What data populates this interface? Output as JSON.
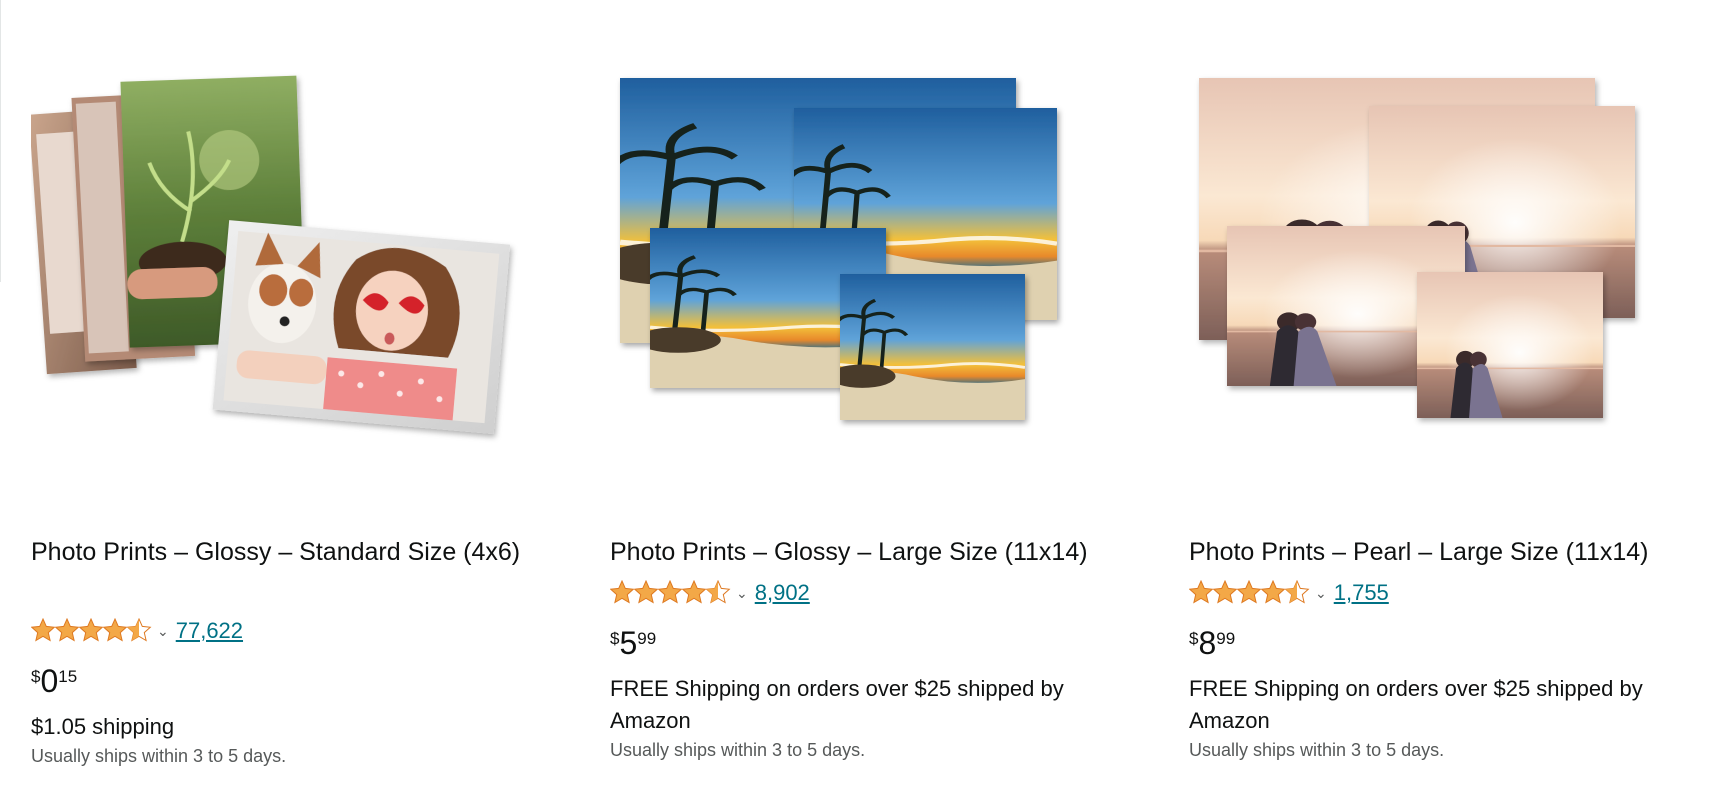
{
  "products": [
    {
      "title": "Photo Prints – Glossy – Standard Size (4x6)",
      "rating": 4.5,
      "rating_label": "4.5 out of 5 stars",
      "review_count": "77,622",
      "price": {
        "symbol": "$",
        "whole": "0",
        "fraction": "15"
      },
      "shipping": "$1.05 shipping",
      "ships_note": "Usually ships within 3 to 5 days."
    },
    {
      "title": "Photo Prints – Glossy – Large Size (11x14)",
      "rating": 4.5,
      "rating_label": "4.5 out of 5 stars",
      "review_count": "8,902",
      "price": {
        "symbol": "$",
        "whole": "5",
        "fraction": "99"
      },
      "shipping": "FREE Shipping on orders over $25 shipped by Amazon",
      "ships_note": "Usually ships within 3 to 5 days."
    },
    {
      "title": "Photo Prints – Pearl – Large Size (11x14)",
      "rating": 4.5,
      "rating_label": "4.5 out of 5 stars",
      "review_count": "1,755",
      "price": {
        "symbol": "$",
        "whole": "8",
        "fraction": "99"
      },
      "shipping": "FREE Shipping on orders over $25 shipped by Amazon",
      "ships_note": "Usually ships within 3 to 5 days."
    }
  ],
  "colors": {
    "star": "#f3a847",
    "star_stroke": "#de7921",
    "link": "#007185",
    "text": "#0f1111",
    "muted": "#565959"
  },
  "icons": {
    "rating_star": "star-icon",
    "rating_dropdown": "chevron-down-icon"
  }
}
